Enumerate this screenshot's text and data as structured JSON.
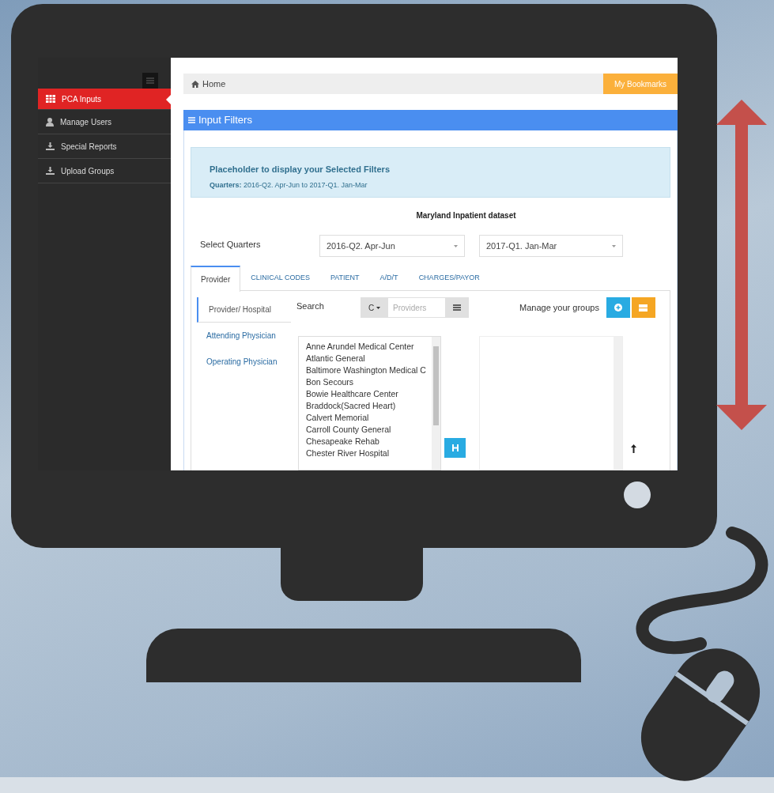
{
  "sidebar": {
    "items": [
      {
        "label": "PCA Inputs",
        "selected": true
      },
      {
        "label": "Manage Users",
        "selected": false
      },
      {
        "label": "Special Reports",
        "selected": false
      },
      {
        "label": "Upload Groups",
        "selected": false
      }
    ]
  },
  "breadcrumb": {
    "home": "Home"
  },
  "bookmarks_button": "My Bookmarks",
  "panel": {
    "title": "Input Filters"
  },
  "selected_filters": {
    "title": "Placeholder to display your Selected Filters",
    "summary": "**Quarters:** 2016-Q2. Apr-Jun to 2017-Q1. Jan-Mar"
  },
  "dataset_title": "Maryland Inpatient dataset",
  "quarters": {
    "label": "Select Quarters",
    "from": "2016-Q2. Apr-Jun",
    "to": "2017-Q1. Jan-Mar"
  },
  "tabs": [
    {
      "label": "Provider",
      "selected": true
    },
    {
      "label": "CLINICAL CODES",
      "selected": false
    },
    {
      "label": "PATIENT",
      "selected": false
    },
    {
      "label": "A/D/T",
      "selected": false
    },
    {
      "label": "CHARGES/PAYOR",
      "selected": false
    }
  ],
  "sub_tabs": [
    {
      "label": "Provider/ Hospital",
      "selected": true
    },
    {
      "label": "Attending Physician",
      "selected": false
    },
    {
      "label": "Operating Physician",
      "selected": false
    }
  ],
  "search": {
    "label": "Search",
    "prefix": "C",
    "placeholder": "Providers"
  },
  "groups": {
    "label": "Manage your groups"
  },
  "providers": [
    "Anne Arundel Medical Center",
    "Atlantic General",
    "Baltimore Washington Medical C",
    "Bon Secours",
    "Bowie Healthcare Center",
    "Braddock(Sacred Heart)",
    "Calvert Memorial",
    "Carroll County General",
    "Chesapeake Rehab",
    "Chester River Hospital"
  ]
}
